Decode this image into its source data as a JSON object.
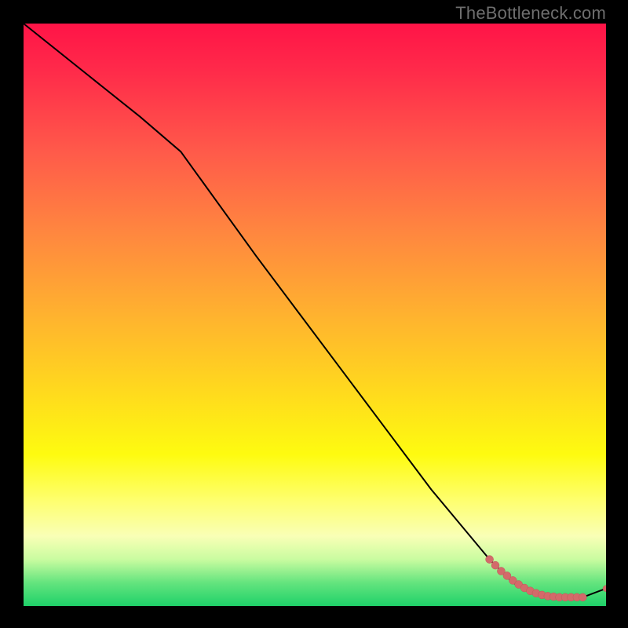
{
  "watermark": "TheBottleneck.com",
  "colors": {
    "line": "#000000",
    "points_fill": "#d36a6a",
    "points_stroke": "#c05858"
  },
  "chart_data": {
    "type": "line",
    "title": "",
    "xlabel": "",
    "ylabel": "",
    "xlim": [
      0,
      100
    ],
    "ylim": [
      0,
      100
    ],
    "grid": false,
    "legend": false,
    "series": [
      {
        "name": "curve",
        "style": "line",
        "x": [
          0,
          10,
          20,
          27,
          40,
          55,
          70,
          80,
          84,
          88,
          92,
          96,
          100
        ],
        "y": [
          100,
          92,
          84,
          78,
          60,
          40,
          20,
          8,
          4,
          2,
          1.5,
          1.5,
          3
        ]
      },
      {
        "name": "cluster",
        "style": "scatter",
        "x": [
          80,
          81,
          82,
          83,
          84,
          85,
          86,
          87,
          88,
          89,
          90,
          91,
          92,
          93,
          94,
          95,
          96,
          100
        ],
        "y": [
          8,
          7,
          6,
          5.2,
          4.4,
          3.7,
          3.1,
          2.6,
          2.2,
          1.9,
          1.7,
          1.6,
          1.5,
          1.5,
          1.5,
          1.5,
          1.5,
          3
        ]
      }
    ]
  }
}
